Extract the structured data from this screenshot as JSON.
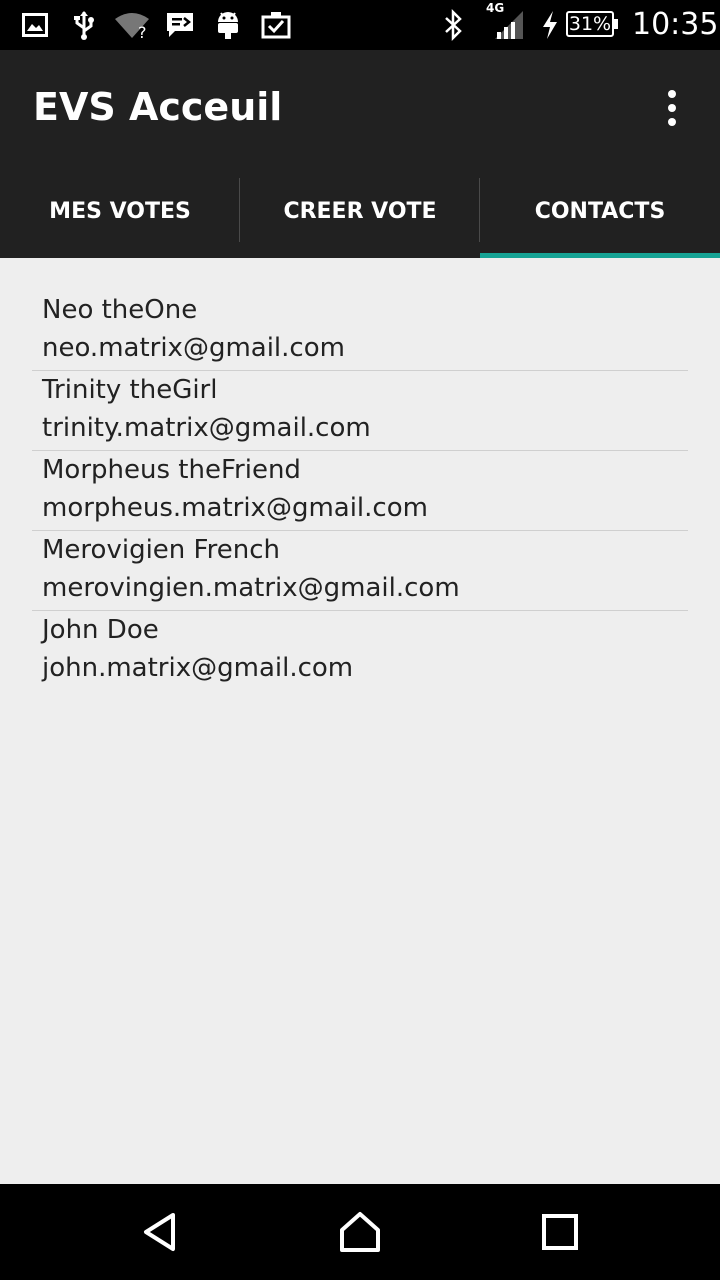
{
  "status_bar": {
    "network_label": "4G",
    "battery": "31%",
    "time": "10:35",
    "icons": [
      "gallery-icon",
      "usb-icon",
      "wifi-unknown-icon",
      "message-icon",
      "android-icon",
      "clipboard-check-icon",
      "bluetooth-icon",
      "signal-icon",
      "charging-icon",
      "battery-icon"
    ]
  },
  "app_bar": {
    "title": "EVS Acceuil",
    "menu_icon": "more-vert-icon"
  },
  "tabs": [
    {
      "label": "MES VOTES",
      "selected": false
    },
    {
      "label": "CREER VOTE",
      "selected": false
    },
    {
      "label": "CONTACTS",
      "selected": true
    }
  ],
  "accent_color": "#16a394",
  "contacts": [
    {
      "name": "Neo theOne",
      "email": "neo.matrix@gmail.com"
    },
    {
      "name": "Trinity theGirl",
      "email": "trinity.matrix@gmail.com"
    },
    {
      "name": "Morpheus theFriend",
      "email": "morpheus.matrix@gmail.com"
    },
    {
      "name": "Merovigien French",
      "email": "merovingien.matrix@gmail.com"
    },
    {
      "name": "John Doe",
      "email": "john.matrix@gmail.com"
    }
  ],
  "nav_bar": {
    "icons": [
      "back-icon",
      "home-icon",
      "recents-icon"
    ]
  }
}
